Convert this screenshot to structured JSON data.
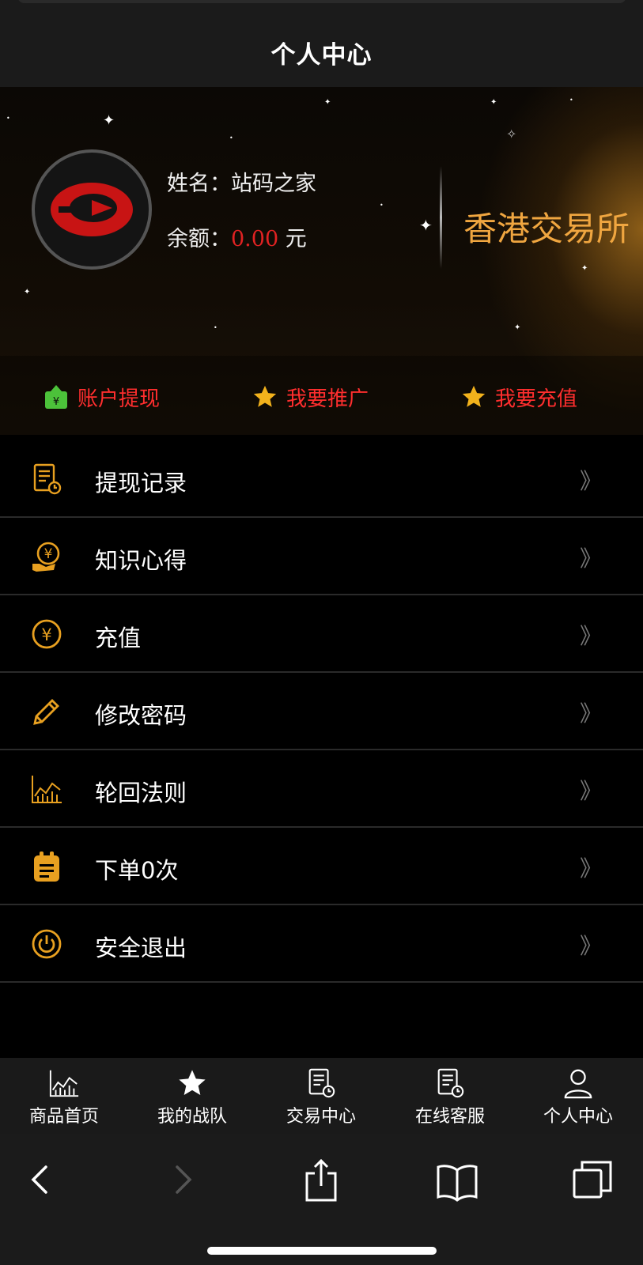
{
  "header": {
    "title": "个人中心"
  },
  "profile": {
    "name_label": "姓名：",
    "name_value": "站码之家",
    "balance_label": "余额：",
    "balance_value": "0.00",
    "balance_unit": "元",
    "brand_text": "香港交易所"
  },
  "actions": [
    {
      "label": "账户提现",
      "icon": "withdraw-icon"
    },
    {
      "label": "我要推广",
      "icon": "star-icon"
    },
    {
      "label": "我要充值",
      "icon": "star-icon"
    }
  ],
  "menu": [
    {
      "label": "提现记录",
      "icon": "record-icon"
    },
    {
      "label": "知识心得",
      "icon": "yen-hand-icon"
    },
    {
      "label": "充值",
      "icon": "yen-circle-icon"
    },
    {
      "label": "修改密码",
      "icon": "pencil-icon"
    },
    {
      "label": "轮回法则",
      "icon": "chart-icon"
    },
    {
      "label": "下单0次",
      "icon": "clipboard-icon"
    },
    {
      "label": "安全退出",
      "icon": "power-icon"
    }
  ],
  "menu_arrow": "》",
  "tabs": [
    {
      "label": "商品首页",
      "icon": "chart-icon"
    },
    {
      "label": "我的战队",
      "icon": "star-icon"
    },
    {
      "label": "交易中心",
      "icon": "record-icon"
    },
    {
      "label": "在线客服",
      "icon": "record-icon"
    },
    {
      "label": "个人中心",
      "icon": "user-icon"
    }
  ],
  "colors": {
    "accent": "#f0a640",
    "red": "#ff2e2e",
    "icon_gold": "#e8a020"
  }
}
